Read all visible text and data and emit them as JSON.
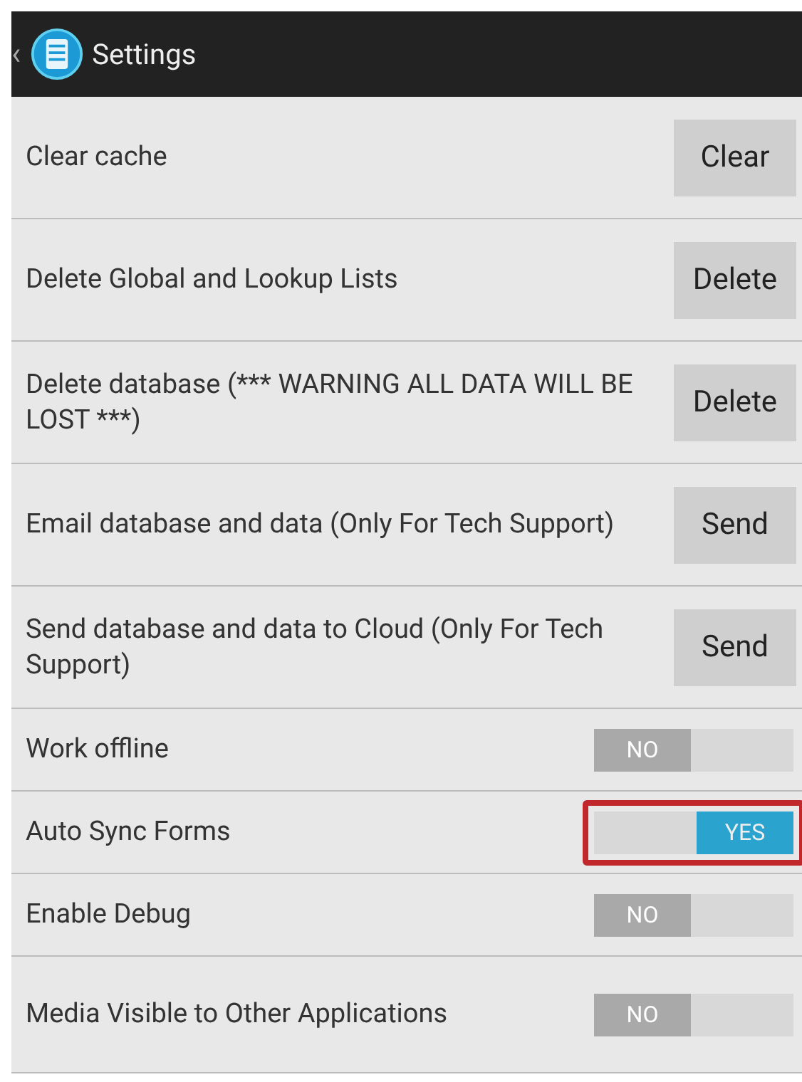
{
  "header": {
    "back": "‹",
    "title": "Settings"
  },
  "items": [
    {
      "kind": "button",
      "label": "Clear cache",
      "button": "Clear"
    },
    {
      "kind": "button",
      "label": "Delete Global and Lookup Lists",
      "button": "Delete"
    },
    {
      "kind": "button",
      "label": "Delete database (*** WARNING ALL DATA WILL BE LOST ***)",
      "button": "Delete"
    },
    {
      "kind": "button",
      "label": "Email database and data (Only For Tech Support)",
      "button": "Send"
    },
    {
      "kind": "button",
      "label": "Send database and data to Cloud (Only For Tech Support)",
      "button": "Send"
    },
    {
      "kind": "toggle",
      "label": "Work offline",
      "on": false,
      "state": "NO",
      "highlighted": false
    },
    {
      "kind": "toggle",
      "label": "Auto Sync Forms",
      "on": true,
      "state": "YES",
      "highlighted": true
    },
    {
      "kind": "toggle",
      "label": "Enable Debug",
      "on": false,
      "state": "NO",
      "highlighted": false
    },
    {
      "kind": "toggle",
      "label": "Media Visible to Other Applications",
      "on": false,
      "state": "NO",
      "highlighted": false
    }
  ]
}
